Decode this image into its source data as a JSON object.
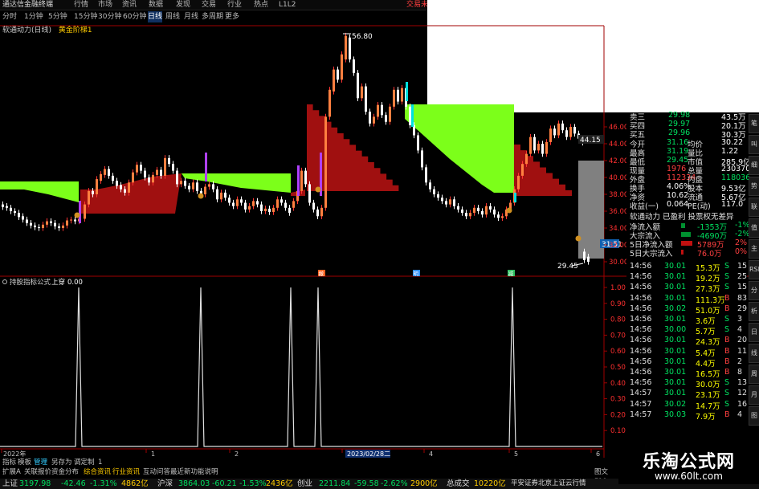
{
  "topbar": {
    "app_title": "通达信金融终端",
    "menus": [
      "行情",
      "市场",
      "资讯",
      "数据",
      "发现",
      "交易",
      "行业",
      "热点",
      "L1L2"
    ],
    "right_label": "交易未"
  },
  "periods": {
    "items": [
      "分时",
      "1分钟",
      "5分钟",
      "15分钟",
      "30分钟",
      "60分钟",
      "日线",
      "周线",
      "月线",
      "多周期",
      "更多"
    ],
    "selected": "日线"
  },
  "main_panel": {
    "indicator_label": "软通动力(日线)",
    "sub_label": "黄金阶梯1",
    "high_marker": "56.80",
    "low_marker": "29.45",
    "current_price_tag": "44.15",
    "right_tag": "31.51",
    "y_ticks": [
      "46.00",
      "44.00",
      "42.00",
      "40.00",
      "38.00",
      "36.00",
      "34.00",
      "32.00",
      "30.00"
    ],
    "event_tags": [
      "撤",
      "明",
      "减"
    ]
  },
  "sub_panel": {
    "title": "持股指标公式",
    "param_label": "上穿",
    "param_value": "0.00",
    "y_ticks": [
      "1.00",
      "0.90",
      "0.80",
      "0.70",
      "0.60",
      "0.50",
      "0.40",
      "0.30",
      "0.20",
      "0.10"
    ],
    "x_labels": [
      "2022年",
      "1",
      "2",
      "2023/02/28二",
      "4",
      "5",
      "6"
    ]
  },
  "quote": {
    "orderbook": [
      {
        "label": "卖三",
        "price": "29.98",
        "vol": "43.5万"
      },
      {
        "label": "买四",
        "price": "29.97",
        "vol": "20.1万"
      },
      {
        "label": "买五",
        "price": "29.96",
        "vol": "30.3万"
      }
    ],
    "stats": [
      {
        "l1": "今开",
        "v1": "31.16",
        "l2": "均价",
        "v2": "30.22"
      },
      {
        "l1": "最高",
        "v1": "31.19",
        "l2": "量比",
        "v2": "1.22"
      },
      {
        "l1": "最低",
        "v1": "29.45",
        "l2": "市值",
        "v2": "285.9亿"
      },
      {
        "l1": "现量",
        "v1": "1976",
        "l2": "总量",
        "v2": "230370"
      },
      {
        "l1": "外盘",
        "v1": "112334",
        "l2": "内盘",
        "v2": "118036"
      },
      {
        "l1": "换手",
        "v1": "4.06%",
        "l2": "股本",
        "v2": "9.53亿"
      },
      {
        "l1": "净资",
        "v1": "10.62",
        "l2": "流通",
        "v2": "5.67亿"
      },
      {
        "l1": "收益(一)",
        "v1": "0.064",
        "l2": "PE(动)",
        "v2": "117.0"
      }
    ],
    "info_line": "软通动力 已盈利 投票权无差异",
    "flows": [
      {
        "label": "净流入额",
        "value": "-1353万",
        "pct": "-1%"
      },
      {
        "label": "大宗流入",
        "value": "-4690万",
        "pct": "-2%"
      },
      {
        "label": "5日净流入额",
        "value": "5789万",
        "pct": "2%"
      },
      {
        "label": "5日大宗流入",
        "value": "76.0万",
        "pct": "0%"
      }
    ],
    "ticks": [
      {
        "time": "14:56",
        "price": "30.01",
        "vol": "15.3万",
        "side": "S",
        "n": "15"
      },
      {
        "time": "14:56",
        "price": "30.01",
        "vol": "19.2万",
        "side": "S",
        "n": "25"
      },
      {
        "time": "14:56",
        "price": "30.01",
        "vol": "27.3万",
        "side": "S",
        "n": "15"
      },
      {
        "time": "14:56",
        "price": "30.01",
        "vol": "111.3万",
        "side": "B",
        "n": "83"
      },
      {
        "time": "14:56",
        "price": "30.02",
        "vol": "51.0万",
        "side": "B",
        "n": "29"
      },
      {
        "time": "14:56",
        "price": "30.01",
        "vol": "3.6万",
        "side": "S",
        "n": "3"
      },
      {
        "time": "14:56",
        "price": "30.00",
        "vol": "5.7万",
        "side": "S",
        "n": "4"
      },
      {
        "time": "14:56",
        "price": "30.01",
        "vol": "24.3万",
        "side": "B",
        "n": "20"
      },
      {
        "time": "14:56",
        "price": "30.01",
        "vol": "5.4万",
        "side": "B",
        "n": "11"
      },
      {
        "time": "14:56",
        "price": "30.01",
        "vol": "4.4万",
        "side": "B",
        "n": "2"
      },
      {
        "time": "14:56",
        "price": "30.01",
        "vol": "16.5万",
        "side": "B",
        "n": "8"
      },
      {
        "time": "14:56",
        "price": "30.01",
        "vol": "30.0万",
        "side": "S",
        "n": "13"
      },
      {
        "time": "14:57",
        "price": "30.01",
        "vol": "23.1万",
        "side": "S",
        "n": "12"
      },
      {
        "time": "14:57",
        "price": "30.02",
        "vol": "14.7万",
        "side": "S",
        "n": "16"
      },
      {
        "time": "14:57",
        "price": "30.03",
        "vol": "7.9万",
        "side": "B",
        "n": "4"
      }
    ]
  },
  "side_tabs": [
    "笔",
    "叫",
    "细",
    "势",
    "联",
    "值",
    "主",
    "RSI",
    "分",
    "析",
    "日",
    "线",
    "周",
    "月",
    "图"
  ],
  "bottom_tabs": [
    "指标",
    "模板",
    "管理",
    "另存为",
    "调定制",
    "1",
    "扩展A",
    "关联报价",
    "资金分布",
    "综合资讯",
    "行业资讯",
    "互动问答",
    "最近新功能说明",
    "图文F10"
  ],
  "statusbar": {
    "sh_label": "上证",
    "sh_val": "3197.98",
    "sh_chg": "-42.46",
    "sh_pct": "-1.31%",
    "sh_amt": "4862亿",
    "sz_label": "沪深",
    "sz_val": "3864.03",
    "sz_chg": "-60.21",
    "sz_pct": "-1.53%",
    "sz_amt": "2436亿",
    "cy_label": "创业",
    "cy_val": "2211.84",
    "cy_chg": "-59.58",
    "cy_pct": "-2.62%",
    "cy_amt": "2900亿",
    "total_label": "总成交",
    "total_val": "10220亿",
    "news": "平安证券北京上证云行情"
  },
  "watermark": {
    "title": "乐淘公式网",
    "url": "www.60lt.com"
  },
  "colors": {
    "up": "#ff3232",
    "down": "#00e0e0",
    "green_fill": "#7cff1a",
    "red_fill": "#a01010",
    "grey_fill": "#808080",
    "axis": "#a00000"
  }
}
